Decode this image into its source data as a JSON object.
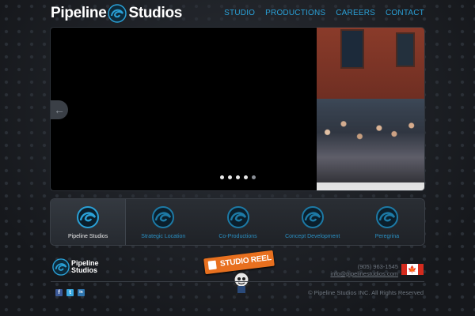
{
  "brand": {
    "name_left": "Pipeline",
    "name_right": "Studios",
    "accent": "#2aa0d6"
  },
  "nav": {
    "items": [
      "STUDIO",
      "PRODUCTIONS",
      "CAREERS",
      "CONTACT"
    ]
  },
  "slider": {
    "prev_icon": "arrow-left-icon",
    "dot_count": 5,
    "active_dot": 4
  },
  "features": [
    {
      "label": "Pipeline Studios"
    },
    {
      "label": "Strategic Location"
    },
    {
      "label": "Co-Productions"
    },
    {
      "label": "Concept Development"
    },
    {
      "label": "Peregrina"
    }
  ],
  "footer": {
    "logo_line1": "Pipeline",
    "logo_line2": "Studios",
    "reel_label": "STUDIO REEL",
    "phone": "(905) 963-1545",
    "email": "info@pipelinestudios.com",
    "copyright": "© Pipeline Studios INC. All Rights Reserved",
    "social": [
      {
        "icon": "facebook-icon",
        "glyph": "f",
        "color": "#3b5998"
      },
      {
        "icon": "twitter-icon",
        "glyph": "t",
        "color": "#3aa8e0"
      },
      {
        "icon": "linkedin-icon",
        "glyph": "in",
        "color": "#2f76b0"
      }
    ]
  }
}
